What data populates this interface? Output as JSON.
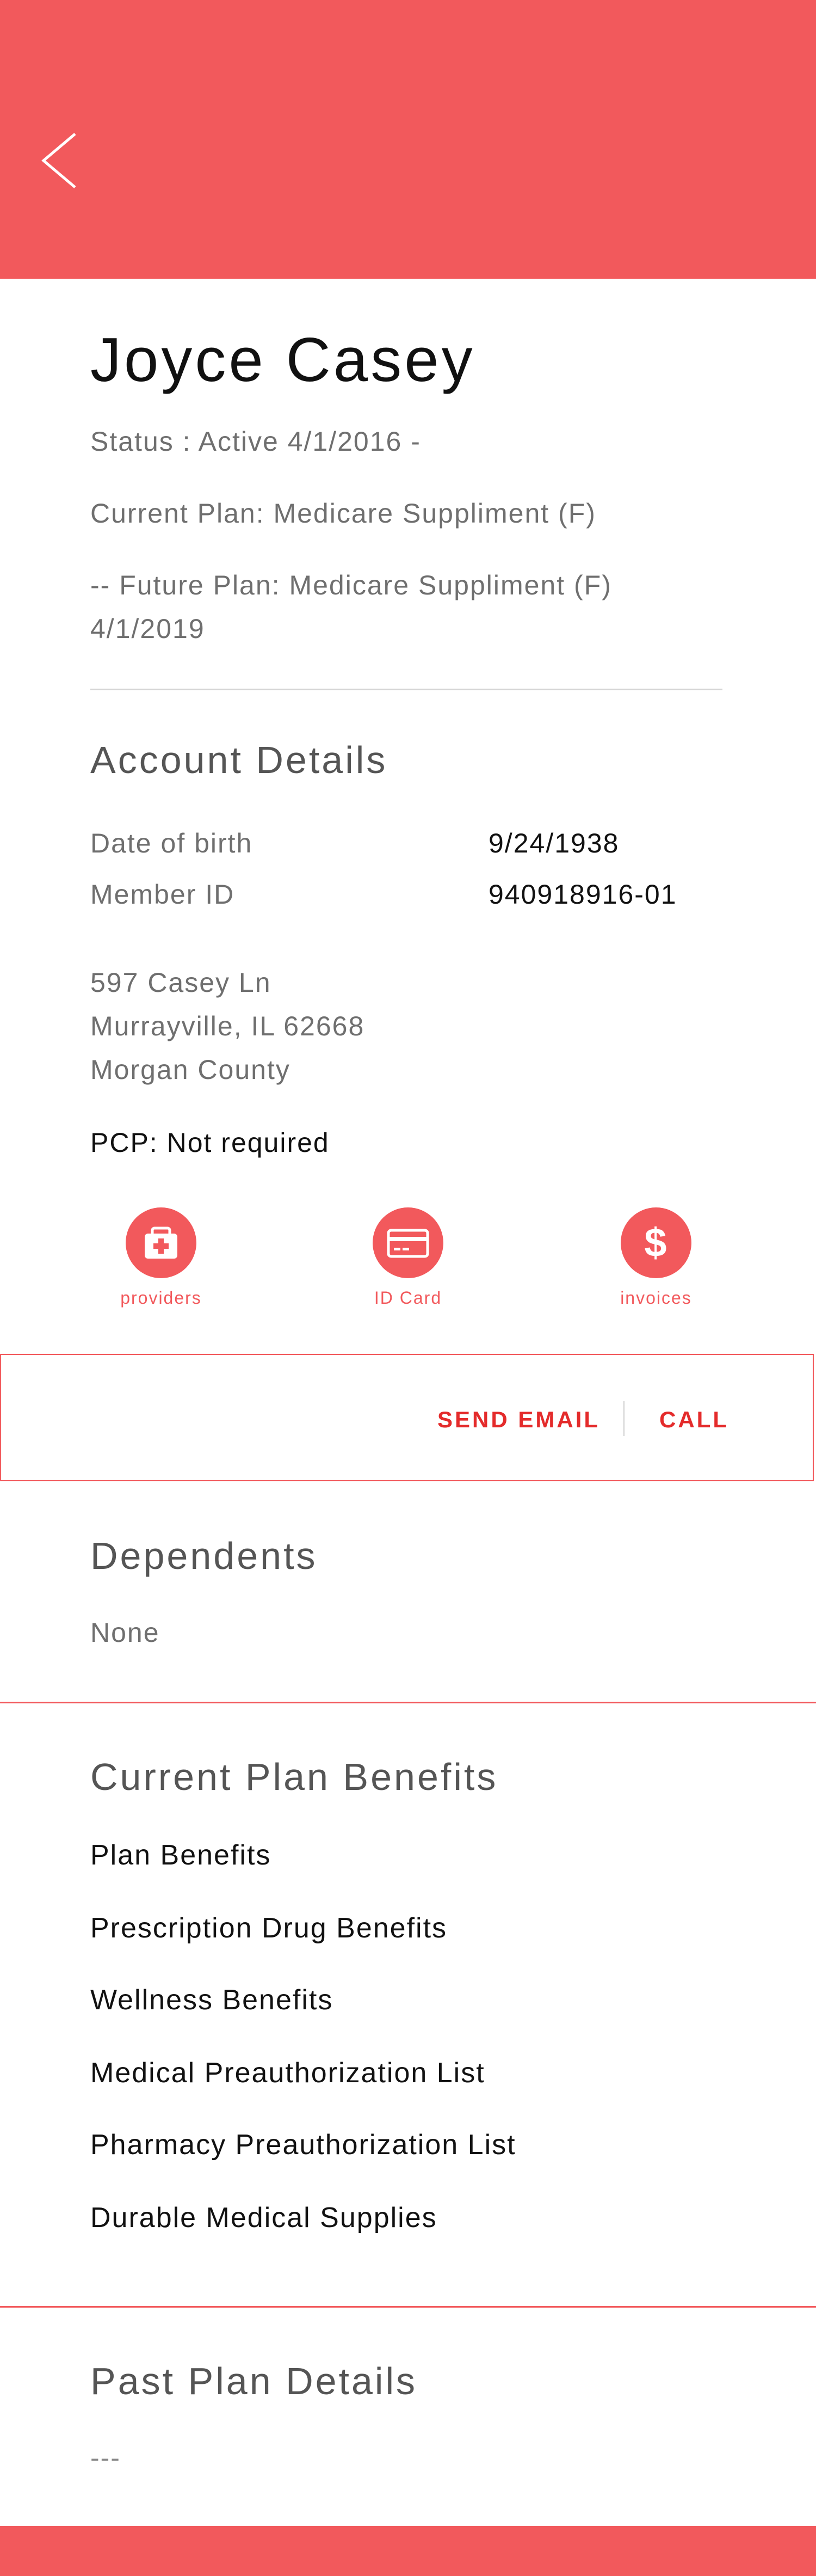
{
  "colors": {
    "accent": "#f2595c",
    "contact_accent": "#e42b2b"
  },
  "header": {
    "back_icon": "chevron-left-icon"
  },
  "member": {
    "name": "Joyce Casey",
    "status": "Status : Active 4/1/2016 -",
    "current_plan": "Current Plan: Medicare Suppliment (F)",
    "future_plan_line1": "-- Future Plan: Medicare Suppliment (F)",
    "future_plan_line2": "4/1/2019"
  },
  "account": {
    "title": "Account Details",
    "dob_label": "Date of birth",
    "dob_value": "9/24/1938",
    "member_id_label": "Member ID",
    "member_id_value": "940918916-01",
    "address_line1": "597 Casey Ln",
    "address_line2": "Murrayville, IL 62668",
    "address_line3": "Morgan County",
    "pcp": "PCP: Not required"
  },
  "actions": [
    {
      "label": "providers",
      "icon": "medical-kit-icon"
    },
    {
      "label": "ID Card",
      "icon": "id-card-icon"
    },
    {
      "label": "invoices",
      "icon": "dollar-icon"
    }
  ],
  "contact": {
    "email_label": "SEND EMAIL",
    "call_label": "CALL"
  },
  "dependents": {
    "title": "Dependents",
    "value": "None"
  },
  "benefits": {
    "title": "Current Plan Benefits",
    "items": [
      "Plan Benefits",
      "Prescription Drug Benefits",
      "Wellness Benefits",
      "Medical Preauthorization List",
      "Pharmacy Preauthorization List",
      "Durable Medical Supplies"
    ]
  },
  "past_plan": {
    "title": "Past Plan Details",
    "value": "---"
  }
}
